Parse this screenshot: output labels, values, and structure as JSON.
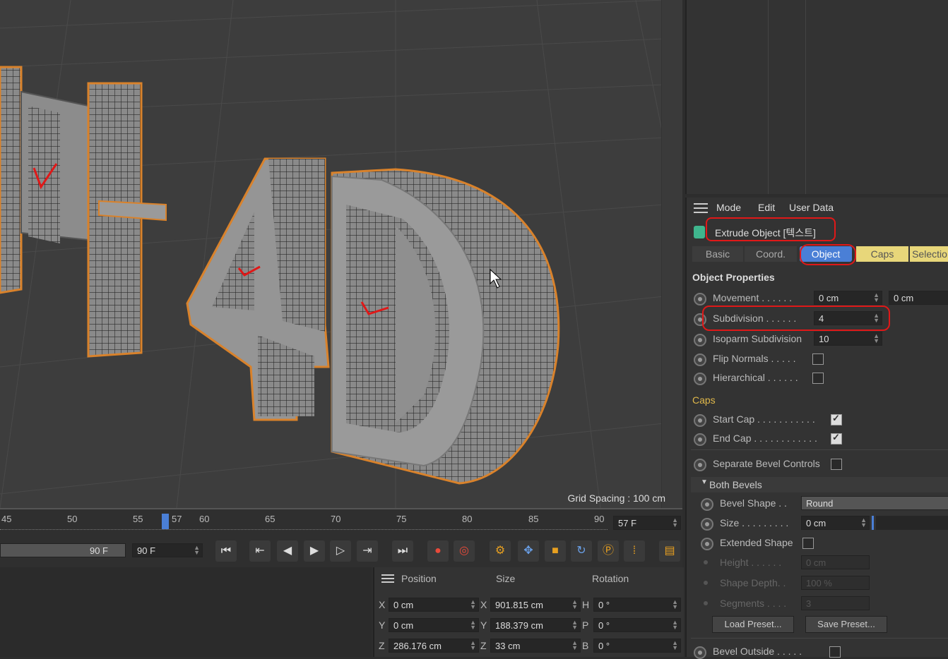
{
  "viewport": {
    "grid_spacing": "Grid Spacing : 100 cm",
    "text_letters": [
      "H",
      "4",
      "D"
    ]
  },
  "attr": {
    "menu": [
      "Mode",
      "Edit",
      "User Data"
    ],
    "object_title": "Extrude Object [텍스트]",
    "tabs": [
      "Basic",
      "Coord.",
      "Object",
      "Caps",
      "Selectio"
    ],
    "active_tab": "Object",
    "object_properties_title": "Object Properties",
    "movement": {
      "label": "Movement . . . . . .",
      "values": [
        "0 cm",
        "0 cm"
      ]
    },
    "subdivision": {
      "label": "Subdivision . . . . . .",
      "value": "4"
    },
    "isoparm": {
      "label": "Isoparm Subdivision",
      "value": "10"
    },
    "flip_normals": {
      "label": "Flip Normals . . . . .",
      "checked": false
    },
    "hierarchical": {
      "label": "Hierarchical . . . . . .",
      "checked": false
    },
    "caps_title": "Caps",
    "start_cap": {
      "label": "Start Cap . . . . . . . . . . .",
      "checked": true
    },
    "end_cap": {
      "label": "End Cap . . . . . . . . . . . .",
      "checked": true
    },
    "separate_bevel": {
      "label": "Separate Bevel Controls",
      "checked": false
    },
    "both_bevels": "Both Bevels",
    "bevel_shape": {
      "label": "Bevel Shape . .",
      "value": "Round"
    },
    "size": {
      "label": "Size . . . . . . . . .",
      "value": "0 cm"
    },
    "extended_shape": {
      "label": "Extended Shape",
      "checked": false
    },
    "height": {
      "label": "Height . . . . . .",
      "value": "0 cm"
    },
    "shape_depth": {
      "label": "Shape Depth. .",
      "value": "100 %"
    },
    "segments": {
      "label": "Segments . . . .",
      "value": "3"
    },
    "load_preset": "Load Preset...",
    "save_preset": "Save Preset...",
    "bevel_outside": "Bevel Outside . . . . ."
  },
  "timeline": {
    "ticks": [
      "45",
      "50",
      "55",
      "57",
      "60",
      "65",
      "70",
      "75",
      "80",
      "85",
      "90"
    ],
    "current_frame": "57 F",
    "end_frame_left": "90 F",
    "end_frame": "90 F"
  },
  "coords": {
    "headers": [
      "Position",
      "Size",
      "Rotation"
    ],
    "rows": [
      {
        "axis": "X",
        "pos": "0 cm",
        "size_axis": "X",
        "size": "901.815 cm",
        "rot_axis": "H",
        "rot": "0 °"
      },
      {
        "axis": "Y",
        "pos": "0 cm",
        "size_axis": "Y",
        "size": "188.379 cm",
        "rot_axis": "P",
        "rot": "0 °"
      },
      {
        "axis": "Z",
        "pos": "286.176 cm",
        "size_axis": "Z",
        "size": "33 cm",
        "rot_axis": "B",
        "rot": "0 °"
      }
    ]
  },
  "colors": {
    "accent_blue": "#4a7fd6",
    "caps_yellow": "#e8d77a",
    "annotation_red": "#e01818",
    "outline_orange": "#d9822b"
  }
}
